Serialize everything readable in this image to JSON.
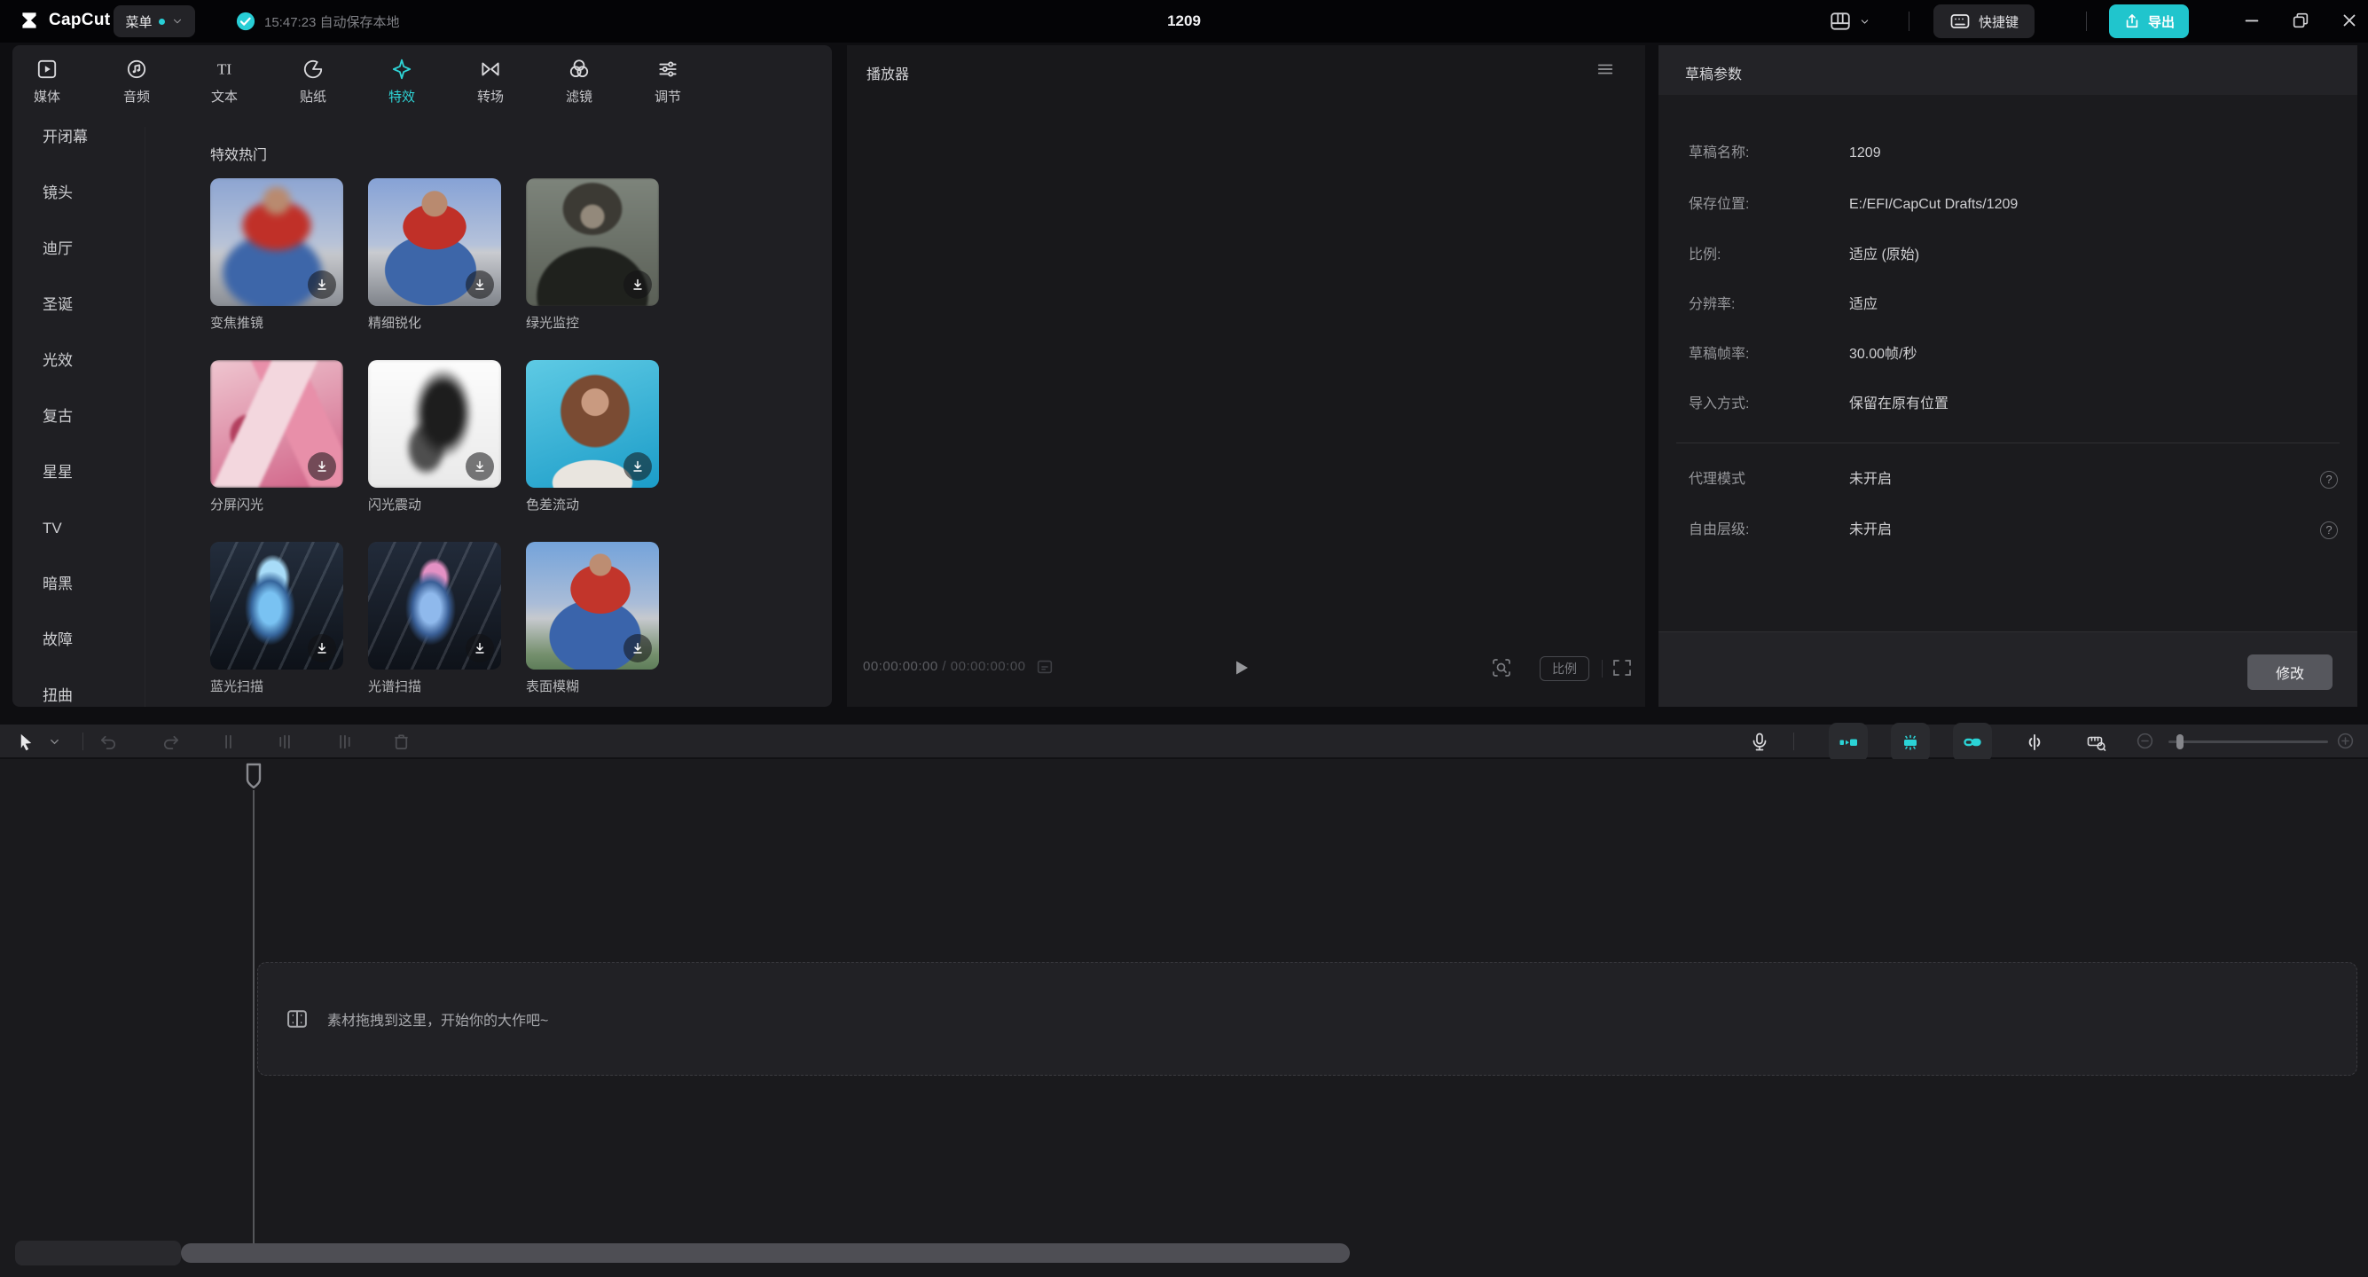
{
  "colors": {
    "accent": "#28ced6",
    "export_button": "#20c5cd",
    "selected_tab": "#2ed4d6"
  },
  "topbar": {
    "app_name": "CapCut",
    "menu": "菜单",
    "autosave": "15:47:23 自动保存本地",
    "title": "1209",
    "shortcuts": "快捷键",
    "export": "导出"
  },
  "tabs": [
    {
      "label": "媒体",
      "selected": false
    },
    {
      "label": "音频",
      "selected": false
    },
    {
      "label": "文本",
      "selected": false
    },
    {
      "label": "贴纸",
      "selected": false
    },
    {
      "label": "特效",
      "selected": true
    },
    {
      "label": "转场",
      "selected": false
    },
    {
      "label": "滤镜",
      "selected": false
    },
    {
      "label": "调节",
      "selected": false
    }
  ],
  "sidebar_categories": [
    "开闭幕",
    "镜头",
    "迪厅",
    "圣诞",
    "光效",
    "复古",
    "星星",
    "TV",
    "暗黑",
    "故障",
    "扭曲"
  ],
  "effects": {
    "section": "特效热门",
    "names": [
      "变焦推镜",
      "精细锐化",
      "绿光监控",
      "分屏闪光",
      "闪光震动",
      "色差流动",
      "蓝光扫描",
      "光谱扫描",
      "表面模糊"
    ]
  },
  "player": {
    "title": "播放器",
    "time_current": "00:00:00:00",
    "time_separator": " / ",
    "time_total": "00:00:00:00",
    "ratio": "比例"
  },
  "draft_params": {
    "title": "草稿参数",
    "rows": [
      {
        "label": "草稿名称:",
        "value": "1209"
      },
      {
        "label": "保存位置:",
        "value": "E:/EFI/CapCut Drafts/1209"
      },
      {
        "label": "比例:",
        "value": "适应 (原始)"
      },
      {
        "label": "分辨率:",
        "value": "适应"
      },
      {
        "label": "草稿帧率:",
        "value": "30.00帧/秒"
      },
      {
        "label": "导入方式:",
        "value": "保留在原有位置"
      }
    ],
    "proxy_label": "代理模式",
    "proxy_value": "未开启",
    "layer_label": "自由层级:",
    "layer_value": "未开启",
    "help_glyph": "?",
    "modify": "修改"
  },
  "timeline": {
    "hint": "素材拖拽到这里，开始你的大作吧~"
  }
}
